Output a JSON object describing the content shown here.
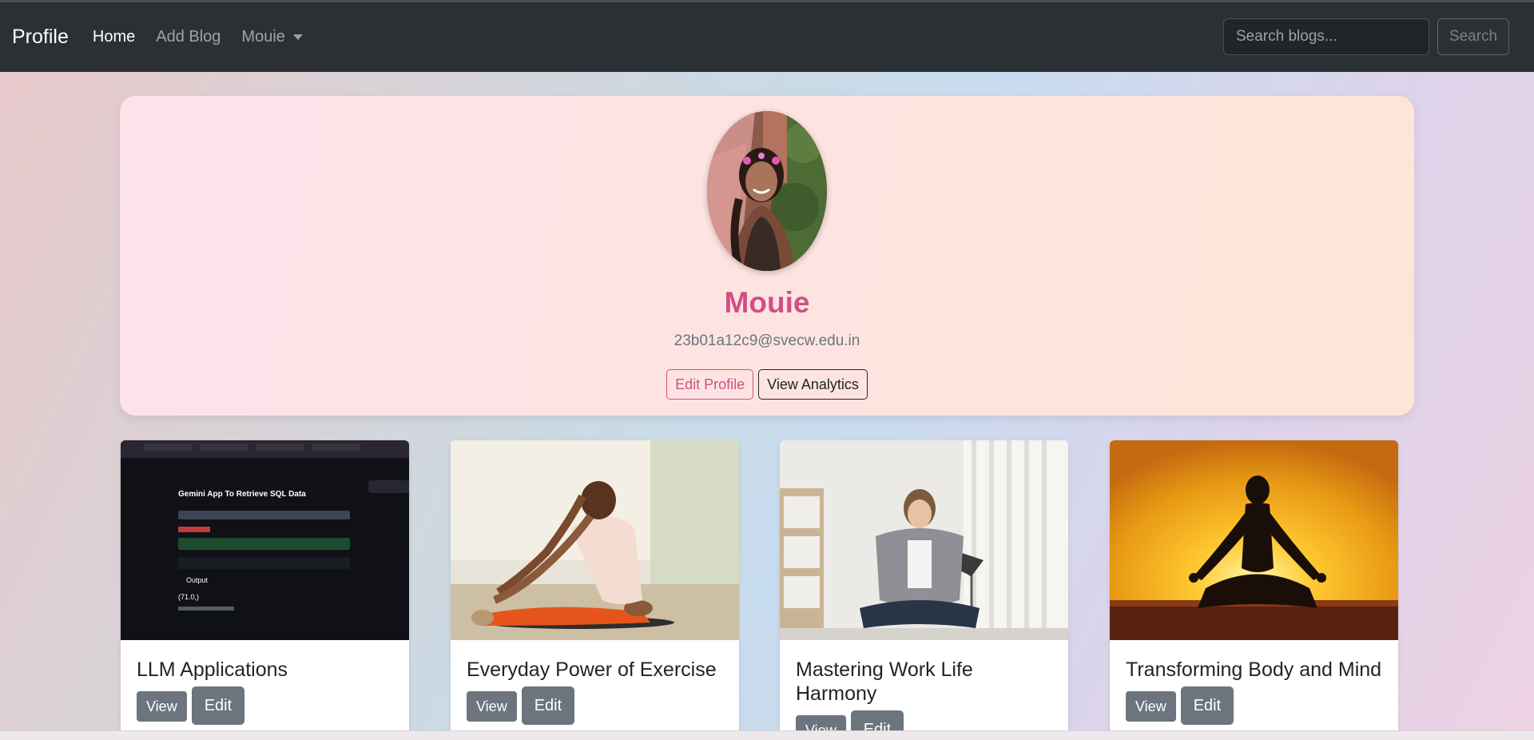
{
  "navbar": {
    "brand": "Profile",
    "links": [
      "Home",
      "Add Blog",
      "Mouie"
    ],
    "search_placeholder": "Search blogs...",
    "search_button": "Search"
  },
  "profile": {
    "name": "Mouie",
    "email": "23b01a12c9@svecw.edu.in",
    "edit_button": "Edit Profile",
    "analytics_button": "View Analytics"
  },
  "cards": [
    {
      "title": "LLM Applications",
      "view": "View",
      "edit": "Edit"
    },
    {
      "title": "Everyday Power of Exercise",
      "view": "View",
      "edit": "Edit"
    },
    {
      "title": "Mastering Work Life Harmony",
      "view": "View",
      "edit": "Edit"
    },
    {
      "title": "Transforming Body and Mind",
      "view": "View",
      "edit": "Edit"
    }
  ],
  "screenshot_text": {
    "app_title": "Gemini App To Retrieve SQL Data",
    "output_label": "Output",
    "output_value": "(71.0,)"
  },
  "colors": {
    "navbar": "#2b3035",
    "accent": "#d14f85",
    "secondary_button": "#6c757d"
  }
}
